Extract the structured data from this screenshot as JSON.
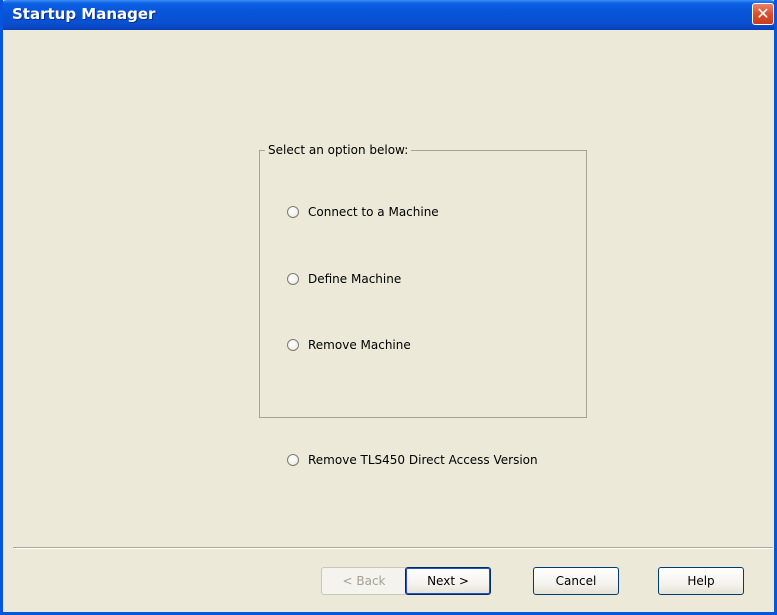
{
  "window": {
    "title": "Startup Manager",
    "close_glyph": "✕"
  },
  "groupbox": {
    "legend": "Select an option below:",
    "options": [
      {
        "label": "Connect to a Machine",
        "selected": false
      },
      {
        "label": "Define Machine",
        "selected": false
      },
      {
        "label": "Remove Machine",
        "selected": false
      }
    ]
  },
  "extra_option": {
    "label": "Remove TLS450 Direct Access Version",
    "selected": false
  },
  "buttons": {
    "back": "< Back",
    "next": "Next >",
    "cancel": "Cancel",
    "help": "Help"
  },
  "colors": {
    "titlebar": "#0854d8",
    "dialog_bg": "#ece9d8",
    "close_button": "#d9502e"
  },
  "icons": {
    "close": "close-icon",
    "radio": "radio-button-icon"
  }
}
